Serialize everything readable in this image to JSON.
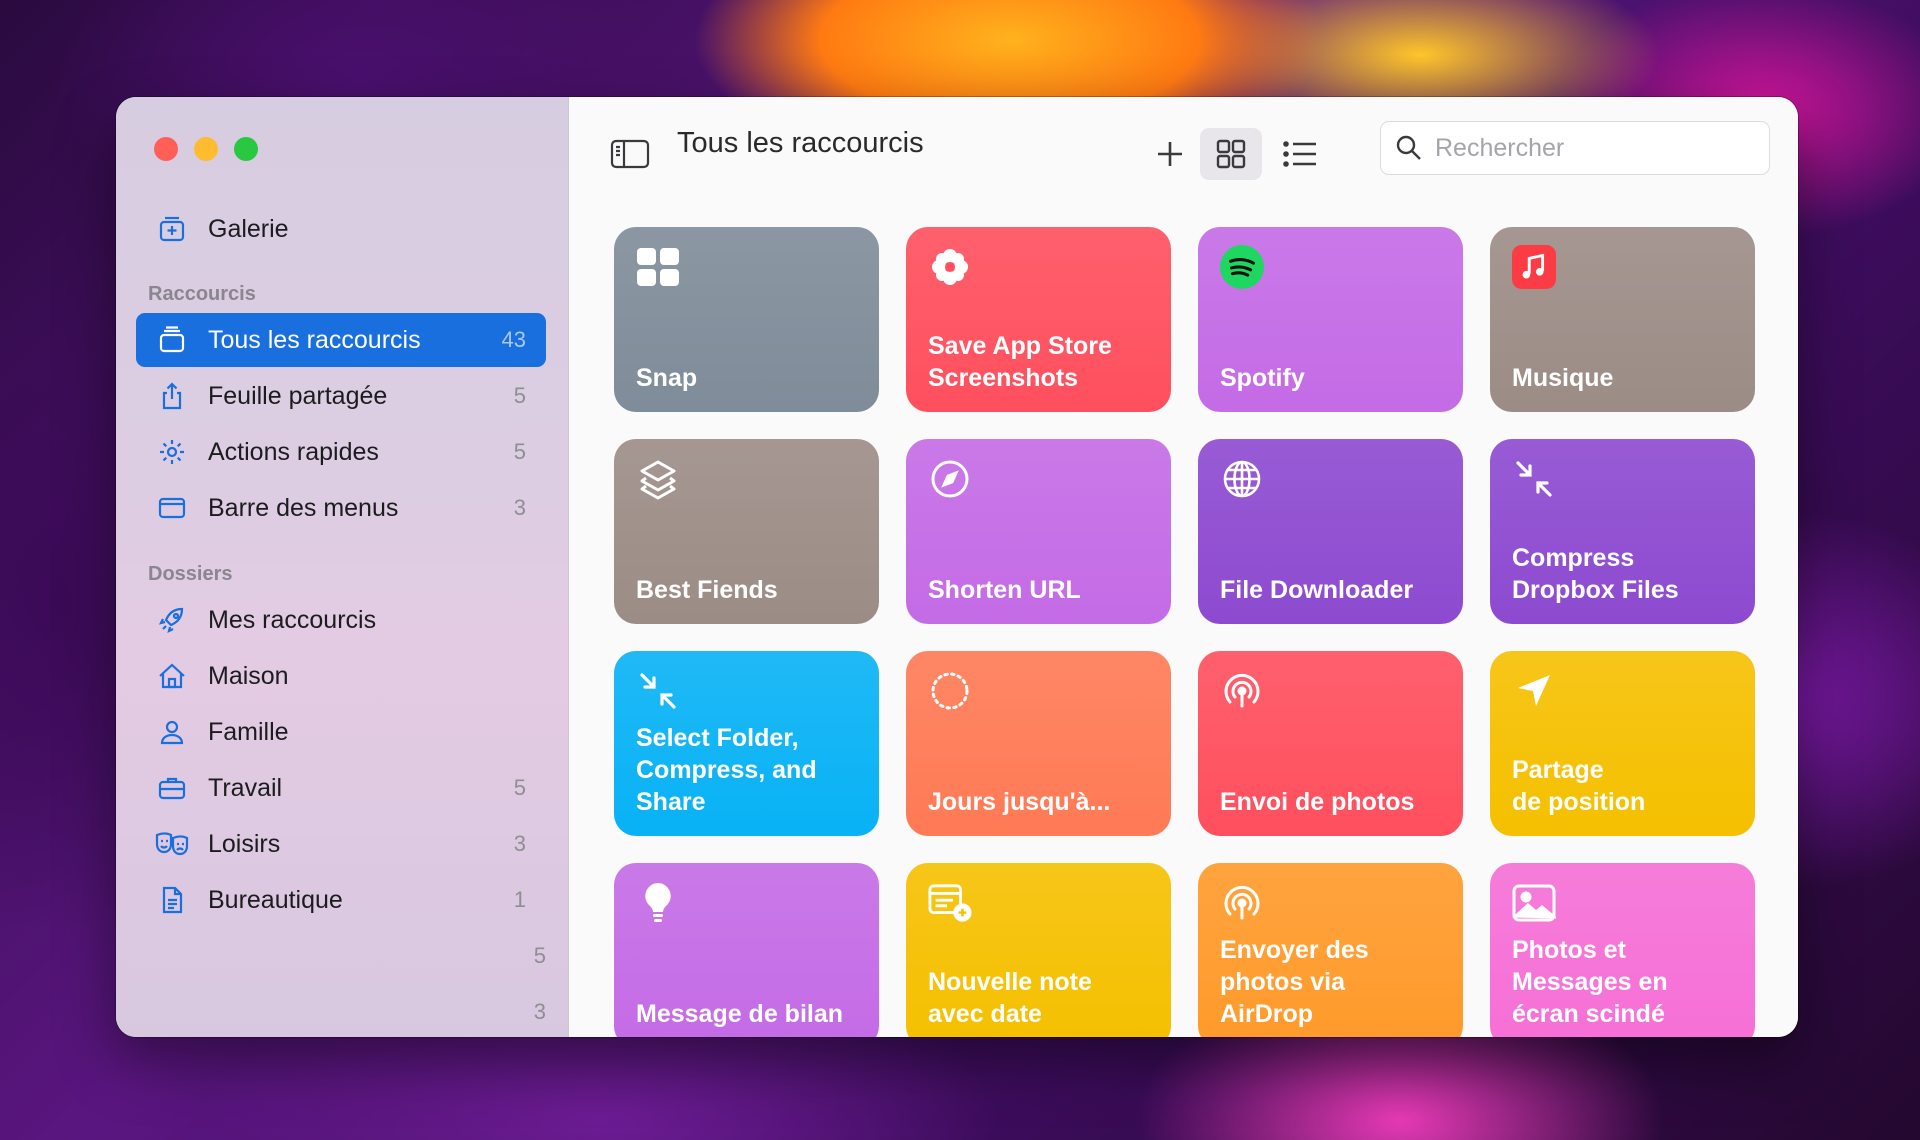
{
  "window": {
    "title": "Tous les raccourcis"
  },
  "sidebar": {
    "gallery_label": "Galerie",
    "section_shortcuts": "Raccourcis",
    "items": [
      {
        "label": "Tous les raccourcis",
        "count": "43",
        "icon": "stack-icon"
      },
      {
        "label": "Feuille partagée",
        "count": "5",
        "icon": "share-icon"
      },
      {
        "label": "Actions rapides",
        "count": "5",
        "icon": "gear-icon"
      },
      {
        "label": "Barre des menus",
        "count": "3",
        "icon": "menubar-icon"
      }
    ],
    "section_folders": "Dossiers",
    "folders": [
      {
        "label": "Mes raccourcis",
        "count": "",
        "icon": "rocket-icon"
      },
      {
        "label": "Maison",
        "count": "",
        "icon": "house-icon"
      },
      {
        "label": "Famille",
        "count": "",
        "icon": "person-icon"
      },
      {
        "label": "Travail",
        "count": "5",
        "icon": "briefcase-icon"
      },
      {
        "label": "Loisirs",
        "count": "3",
        "icon": "theater-masks-icon"
      },
      {
        "label": "Bureautique",
        "count": "1",
        "icon": "document-icon"
      }
    ],
    "extra_counts": [
      "5",
      "3"
    ]
  },
  "toolbar": {
    "search_placeholder": "Rechercher"
  },
  "tiles": [
    {
      "label": "Snap",
      "icon": "grid-squares-icon",
      "color": "#7f8c99"
    },
    {
      "label": "Save App Store\nScreenshots",
      "icon": "flower-icon",
      "color": "#ff4f5e"
    },
    {
      "label": "Spotify",
      "icon": "spotify-icon",
      "color": "#c46be6"
    },
    {
      "label": "Musique",
      "icon": "music-icon",
      "color": "#9c8c86"
    },
    {
      "label": "Best Fiends",
      "icon": "layers-icon",
      "color": "#9c8c86"
    },
    {
      "label": "Shorten URL",
      "icon": "compass-icon",
      "color": "#c46be6"
    },
    {
      "label": "File Downloader",
      "icon": "globe-icon",
      "color": "#8d4ad0"
    },
    {
      "label": "Compress\nDropbox Files",
      "icon": "arrows-in-icon",
      "color": "#8d4ad0"
    },
    {
      "label": "Select Folder,\nCompress, and\nShare",
      "icon": "arrows-in-icon",
      "color": "#08b2f5"
    },
    {
      "label": "Jours jusqu'à...",
      "icon": "dotted-circle-icon",
      "color": "#ff7a55"
    },
    {
      "label": "Envoi de photos",
      "icon": "airdrop-icon",
      "color": "#ff4f5e"
    },
    {
      "label": "Partage\nde position",
      "icon": "location-arrow-icon",
      "color": "#f5c000"
    },
    {
      "label": "Message de bilan",
      "icon": "lightbulb-icon",
      "color": "#c46be6"
    },
    {
      "label": "Nouvelle note\navec date",
      "icon": "note-add-icon",
      "color": "#f5c000"
    },
    {
      "label": "Envoyer des\nphotos via\nAirDrop",
      "icon": "airdrop-icon",
      "color": "#ff9a2a"
    },
    {
      "label": "Photos et\nMessages en\nécran scindé",
      "icon": "photo-icon",
      "color": "#f66fd6"
    }
  ]
}
